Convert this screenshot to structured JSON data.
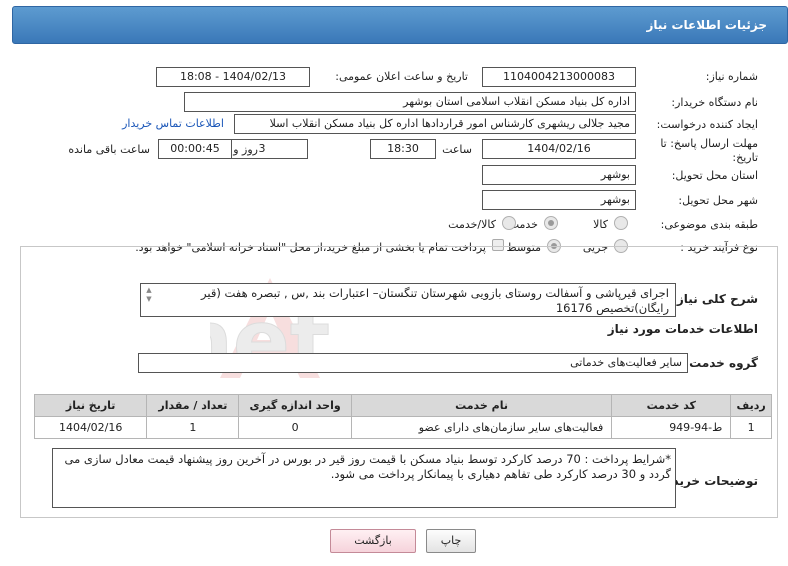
{
  "header": {
    "title": "جزئیات اطلاعات نیاز"
  },
  "need_number": {
    "label": "شماره نیاز:",
    "value": "1104004213000083"
  },
  "announce_date": {
    "label": "تاریخ و ساعت اعلان عمومی:",
    "value": "1404/02/13 - 18:08"
  },
  "buyer_org": {
    "label": "نام دستگاه خریدار:",
    "value": "اداره کل بنیاد مسکن انقلاب اسلامی استان بوشهر"
  },
  "creator": {
    "label": "ایجاد کننده درخواست:",
    "value": "مجید جلالی ریشهری کارشناس امور قراردادها اداره کل بنیاد مسکن انقلاب اسلا",
    "contact_link": "اطلاعات تماس خریدار"
  },
  "deadline": {
    "label": "مهلت ارسال پاسخ: تا تاریخ:",
    "date": "1404/02/16",
    "time_label": "ساعت",
    "time": "18:30",
    "days": "3",
    "days_label": "روز و",
    "remaining": "00:00:45",
    "remaining_label": "ساعت باقی مانده"
  },
  "delivery_province": {
    "label": "استان محل تحویل:",
    "value": "بوشهر"
  },
  "delivery_city": {
    "label": "شهر محل تحویل:",
    "value": "بوشهر"
  },
  "category": {
    "label": "طبقه بندی موضوعی:",
    "options": [
      "کالا",
      "خدمت",
      "کالا/خدمت"
    ],
    "selected": "خدمت"
  },
  "purchase_process": {
    "label": "نوع فرآیند خرید :",
    "options": [
      "جزیی",
      "متوسط"
    ],
    "selected": "متوسط",
    "treasury_note": "پرداخت تمام یا بخشی از مبلغ خرید،از محل \"اسناد خزانه اسلامی\" خواهد بود."
  },
  "summary": {
    "label": "شرح کلی نیاز:",
    "line1": "اجرای قیرپاشی و آسفالت روستای بازویی شهرستان تنگستان– اعتبارات بند ,س , تبصره هفت (قیر",
    "line2": "رایگان)تخصیص 16176"
  },
  "services_heading": "اطلاعات خدمات مورد نیاز",
  "service_group": {
    "label": "گروه خدمت:",
    "value": "سایر فعالیت‌های خدماتی"
  },
  "table": {
    "headers": [
      "ردیف",
      "کد خدمت",
      "نام خدمت",
      "واحد اندازه گیری",
      "تعداد / مقدار",
      "تاریخ نیاز"
    ],
    "rows": [
      [
        "1",
        "ط-94-949",
        "فعالیت‌های سایر سازمان‌های دارای عضو",
        "0",
        "1",
        "1404/02/16"
      ]
    ]
  },
  "buyer_notes": {
    "label": "توضیحات خریدار:",
    "line1": "*شرایط پرداخت : 70 درصد کارکرد توسط بنیاد مسکن با قیمت روز قیر در بورس در آخرین روز پیشنهاد قیمت معادل سازی می",
    "line2": "گردد و 30 درصد کارکرد طی تفاهم دهیاری با پیمانکار پرداخت می شود."
  },
  "buttons": {
    "print": "چاپ",
    "back": "بازگشت"
  },
  "watermark": {
    "text": "AriaTender.net"
  }
}
